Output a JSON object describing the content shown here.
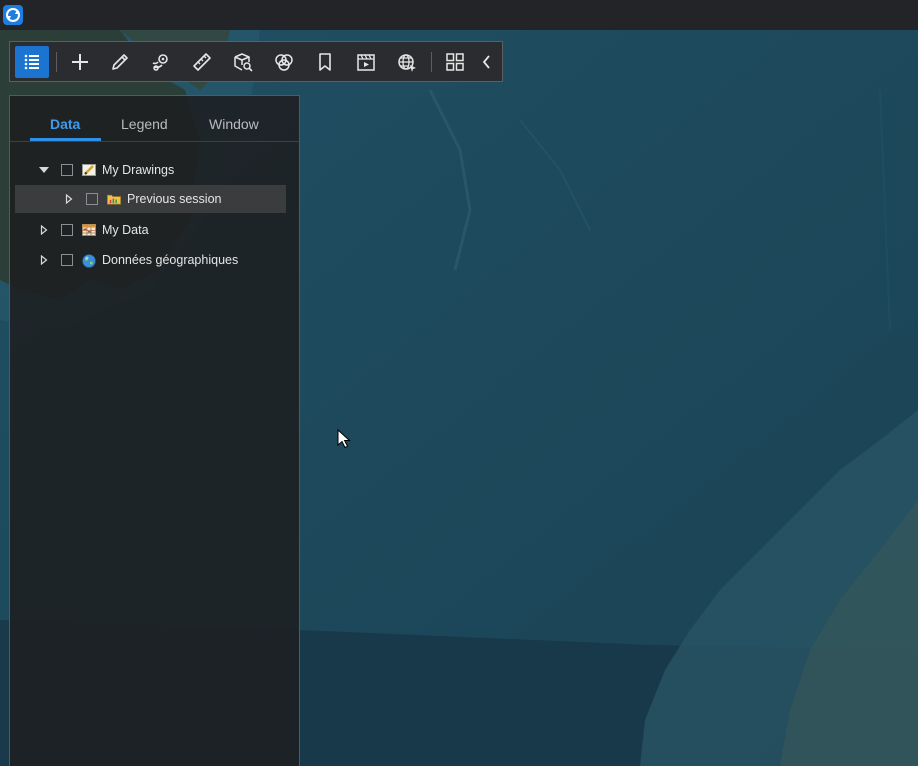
{
  "app": {
    "logo_icon": "sync-logo-icon",
    "accent_color": "#1b74d0"
  },
  "toolbar": {
    "tools": [
      {
        "name": "layer-list",
        "icon": "list-icon",
        "active": true
      },
      {
        "name": "add",
        "icon": "plus-icon"
      },
      {
        "name": "draw",
        "icon": "pencil-icon"
      },
      {
        "name": "locate",
        "icon": "pin-icon"
      },
      {
        "name": "measure",
        "icon": "ruler-icon"
      },
      {
        "name": "analysis",
        "icon": "cube-search-icon"
      },
      {
        "name": "overlay",
        "icon": "overlap-icon"
      },
      {
        "name": "bookmark",
        "icon": "bookmark-icon"
      },
      {
        "name": "presentation",
        "icon": "film-icon"
      },
      {
        "name": "web-services",
        "icon": "globe-icon"
      },
      {
        "name": "widgets",
        "icon": "grid-icon"
      },
      {
        "name": "collapse",
        "icon": "chevron-left-icon"
      }
    ]
  },
  "panel": {
    "tabs": [
      {
        "label": "Data",
        "active": true
      },
      {
        "label": "Legend",
        "active": false
      },
      {
        "label": "Window",
        "active": false
      }
    ],
    "tree": [
      {
        "label": "My Drawings",
        "expanded": true,
        "level": 0,
        "icon": "drawing-icon"
      },
      {
        "label": "Previous session",
        "expanded": false,
        "level": 1,
        "icon": "folder-chart-icon",
        "selected": true
      },
      {
        "label": "My Data",
        "expanded": false,
        "level": 0,
        "icon": "table-icon"
      },
      {
        "label": "Données géographiques",
        "expanded": false,
        "level": 0,
        "icon": "globe-color-icon"
      }
    ]
  }
}
